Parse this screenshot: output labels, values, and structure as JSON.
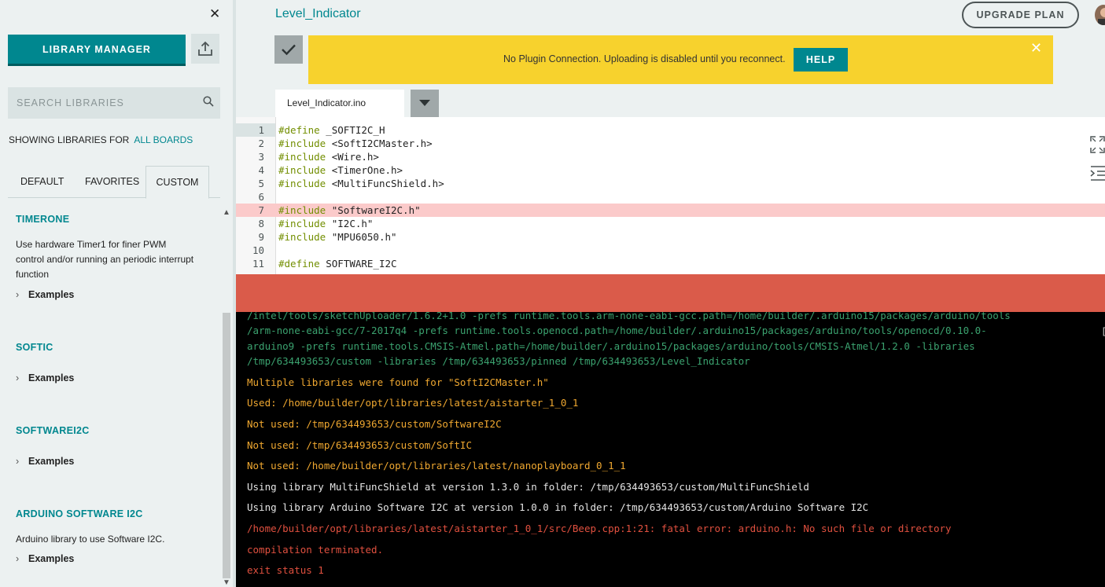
{
  "sidebar": {
    "close_glyph": "✕",
    "library_manager_label": "LIBRARY MANAGER",
    "search_placeholder": "SEARCH LIBRARIES",
    "showing_prefix": "SHOWING LIBRARIES FOR",
    "showing_link": "ALL BOARDS",
    "tabs": [
      {
        "label": "DEFAULT",
        "active": false
      },
      {
        "label": "FAVORITES",
        "active": false
      },
      {
        "label": "CUSTOM",
        "active": true
      }
    ],
    "libraries": [
      {
        "title": "TIMERONE",
        "description": "Use hardware Timer1 for finer PWM control and/or running an periodic interrupt function",
        "examples_label": "Examples"
      },
      {
        "title": "SOFTIC",
        "description": "",
        "examples_label": "Examples"
      },
      {
        "title": "SOFTWAREI2C",
        "description": "",
        "examples_label": "Examples"
      },
      {
        "title": "ARDUINO SOFTWARE I2C",
        "description": "Arduino library to use Software I2C.",
        "examples_label": "Examples"
      }
    ]
  },
  "header": {
    "sketch_title": "Level_Indicator",
    "upgrade_label": "UPGRADE PLAN"
  },
  "banner": {
    "message": "No Plugin Connection. Uploading is disabled until you reconnect.",
    "help_label": "HELP",
    "close_glyph": "✕"
  },
  "file_tab": {
    "name": "Level_Indicator.ino"
  },
  "editor": {
    "lines": [
      {
        "num": "1",
        "kw": "#define",
        "rest": " _SOFTI2C_H"
      },
      {
        "num": "2",
        "kw": "#include",
        "rest": " <SoftI2CMaster.h>"
      },
      {
        "num": "3",
        "kw": "#include",
        "rest": " <Wire.h>"
      },
      {
        "num": "4",
        "kw": "#include",
        "rest": " <TimerOne.h>"
      },
      {
        "num": "5",
        "kw": "#include",
        "rest": " <MultiFuncShield.h>"
      },
      {
        "num": "6",
        "kw": "",
        "rest": ""
      },
      {
        "num": "7",
        "kw": "#include",
        "rest": " \"SoftwareI2C.h\""
      },
      {
        "num": "8",
        "kw": "#include",
        "rest": " \"I2C.h\""
      },
      {
        "num": "9",
        "kw": "#include",
        "rest": " \"MPU6050.h\""
      },
      {
        "num": "10",
        "kw": "",
        "rest": ""
      },
      {
        "num": "11",
        "kw": "#define",
        "rest": " SOFTWARE_I2C"
      }
    ]
  },
  "console": {
    "command_lines": [
      "/intel/tools/sketchUploader/1.6.2+1.0 -prefs runtime.tools.arm-none-eabi-gcc.path=/home/builder/.arduino15/packages/arduino/tools",
      "/arm-none-eabi-gcc/7-2017q4 -prefs runtime.tools.openocd.path=/home/builder/.arduino15/packages/arduino/tools/openocd/0.10.0-",
      "arduino9 -prefs runtime.tools.CMSIS-Atmel.path=/home/builder/.arduino15/packages/arduino/tools/CMSIS-Atmel/1.2.0 -libraries",
      "/tmp/634493653/custom -libraries /tmp/634493653/pinned /tmp/634493653/Level_Indicator"
    ],
    "warn_lines": [
      "Multiple libraries were found for \"SoftI2CMaster.h\"",
      "Used: /home/builder/opt/libraries/latest/aistarter_1_0_1",
      "Not used: /tmp/634493653/custom/SoftwareI2C",
      "Not used: /tmp/634493653/custom/SoftIC",
      "Not used: /home/builder/opt/libraries/latest/nanoplayboard_0_1_1"
    ],
    "info_lines": [
      "Using library MultiFuncShield at version 1.3.0 in folder: /tmp/634493653/custom/MultiFuncShield",
      "Using library Arduino Software I2C at version 1.0.0 in folder: /tmp/634493653/custom/Arduino Software I2C"
    ],
    "error_lines": [
      "/home/builder/opt/libraries/latest/aistarter_1_0_1/src/Beep.cpp:1:21: fatal error: arduino.h: No such file or directory",
      "compilation terminated.",
      "exit status 1"
    ]
  },
  "colors": {
    "accent": "#00878f",
    "banner": "#f7d22d",
    "error_bar": "#da5b4a",
    "error_line": "#fbcaca",
    "console_bg": "#000000"
  }
}
